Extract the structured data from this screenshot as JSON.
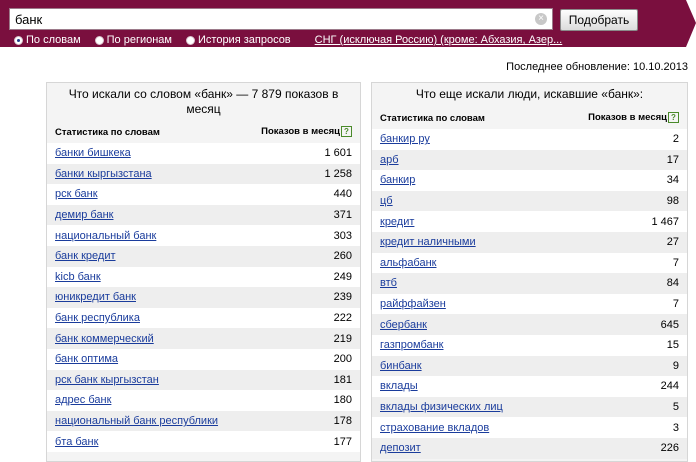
{
  "search": {
    "query": "банк",
    "submit_label": "Подобрать",
    "clear_symbol": "×"
  },
  "modes": [
    {
      "label": "По словам",
      "checked": true
    },
    {
      "label": "По регионам",
      "checked": false
    },
    {
      "label": "История запросов",
      "checked": false
    }
  ],
  "region": {
    "label": "СНГ (исключая Россию) (кроме: Абхазия, Азер..."
  },
  "last_update": "Последнее обновление: 10.10.2013",
  "left_panel": {
    "title": "Что искали со словом «банк» — 7 879 показов в месяц",
    "col_keyword": "Статистика по словам",
    "col_count": "Показов в месяц",
    "help": "?",
    "rows": [
      {
        "kw": "банки бишкека",
        "n": "1 601"
      },
      {
        "kw": "банки кыргызстана",
        "n": "1 258"
      },
      {
        "kw": "рск банк",
        "n": "440"
      },
      {
        "kw": "демир банк",
        "n": "371"
      },
      {
        "kw": "национальный банк",
        "n": "303"
      },
      {
        "kw": "банк кредит",
        "n": "260"
      },
      {
        "kw": "kicb банк",
        "n": "249"
      },
      {
        "kw": "юникредит банк",
        "n": "239"
      },
      {
        "kw": "банк республика",
        "n": "222"
      },
      {
        "kw": "банк коммерческий",
        "n": "219"
      },
      {
        "kw": "банк оптима",
        "n": "200"
      },
      {
        "kw": "рск банк кыргызстан",
        "n": "181"
      },
      {
        "kw": "адрес банк",
        "n": "180"
      },
      {
        "kw": "национальный банк республики",
        "n": "178"
      },
      {
        "kw": "бта банк",
        "n": "177"
      }
    ]
  },
  "right_panel": {
    "title": "Что еще искали люди, искавшие «банк»:",
    "col_keyword": "Статистика по словам",
    "col_count": "Показов в месяц",
    "help": "?",
    "rows": [
      {
        "kw": "банкир ру",
        "n": "2"
      },
      {
        "kw": "арб",
        "n": "17"
      },
      {
        "kw": "банкир",
        "n": "34"
      },
      {
        "kw": "цб",
        "n": "98"
      },
      {
        "kw": "кредит",
        "n": "1 467"
      },
      {
        "kw": "кредит наличными",
        "n": "27"
      },
      {
        "kw": "альфабанк",
        "n": "7"
      },
      {
        "kw": "втб",
        "n": "84"
      },
      {
        "kw": "райффайзен",
        "n": "7"
      },
      {
        "kw": "сбербанк",
        "n": "645"
      },
      {
        "kw": "газпромбанк",
        "n": "15"
      },
      {
        "kw": "бинбанк",
        "n": "9"
      },
      {
        "kw": "вклады",
        "n": "244"
      },
      {
        "kw": "вклады физических лиц",
        "n": "5"
      },
      {
        "kw": "страхование вкладов",
        "n": "3"
      },
      {
        "kw": "депозит",
        "n": "226"
      }
    ]
  }
}
